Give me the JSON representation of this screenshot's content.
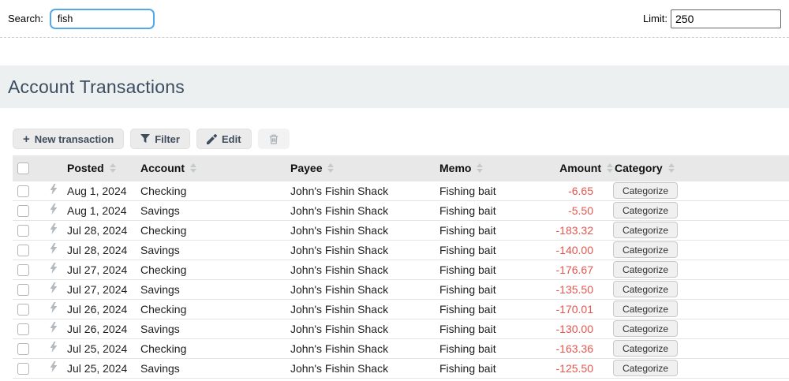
{
  "topbar": {
    "search_label": "Search:",
    "search_value": "fish",
    "limit_label": "Limit:",
    "limit_value": "250"
  },
  "section": {
    "title": "Account Transactions"
  },
  "toolbar": {
    "new_transaction_label": "New transaction",
    "plus_glyph": "+",
    "filter_label": "Filter",
    "edit_label": "Edit"
  },
  "table": {
    "columns": [
      "Posted",
      "Account",
      "Payee",
      "Memo",
      "Amount",
      "Category"
    ],
    "categorize_label": "Categorize",
    "rows": [
      {
        "posted": "Aug 1, 2024",
        "account": "Checking",
        "payee": "John's Fishin Shack",
        "memo": "Fishing bait",
        "amount": "-6.65"
      },
      {
        "posted": "Aug 1, 2024",
        "account": "Savings",
        "payee": "John's Fishin Shack",
        "memo": "Fishing bait",
        "amount": "-5.50"
      },
      {
        "posted": "Jul 28, 2024",
        "account": "Checking",
        "payee": "John's Fishin Shack",
        "memo": "Fishing bait",
        "amount": "-183.32"
      },
      {
        "posted": "Jul 28, 2024",
        "account": "Savings",
        "payee": "John's Fishin Shack",
        "memo": "Fishing bait",
        "amount": "-140.00"
      },
      {
        "posted": "Jul 27, 2024",
        "account": "Checking",
        "payee": "John's Fishin Shack",
        "memo": "Fishing bait",
        "amount": "-176.67"
      },
      {
        "posted": "Jul 27, 2024",
        "account": "Savings",
        "payee": "John's Fishin Shack",
        "memo": "Fishing bait",
        "amount": "-135.50"
      },
      {
        "posted": "Jul 26, 2024",
        "account": "Checking",
        "payee": "John's Fishin Shack",
        "memo": "Fishing bait",
        "amount": "-170.01"
      },
      {
        "posted": "Jul 26, 2024",
        "account": "Savings",
        "payee": "John's Fishin Shack",
        "memo": "Fishing bait",
        "amount": "-130.00"
      },
      {
        "posted": "Jul 25, 2024",
        "account": "Checking",
        "payee": "John's Fishin Shack",
        "memo": "Fishing bait",
        "amount": "-163.36"
      },
      {
        "posted": "Jul 25, 2024",
        "account": "Savings",
        "payee": "John's Fishin Shack",
        "memo": "Fishing bait",
        "amount": "-125.50"
      }
    ]
  },
  "colors": {
    "focus_blue": "#52a8e8",
    "amount_negative": "#e4564e",
    "title_text": "#3b4d5e",
    "band_bg": "#edf0f1",
    "table_header_bg": "#e8e8e8"
  }
}
